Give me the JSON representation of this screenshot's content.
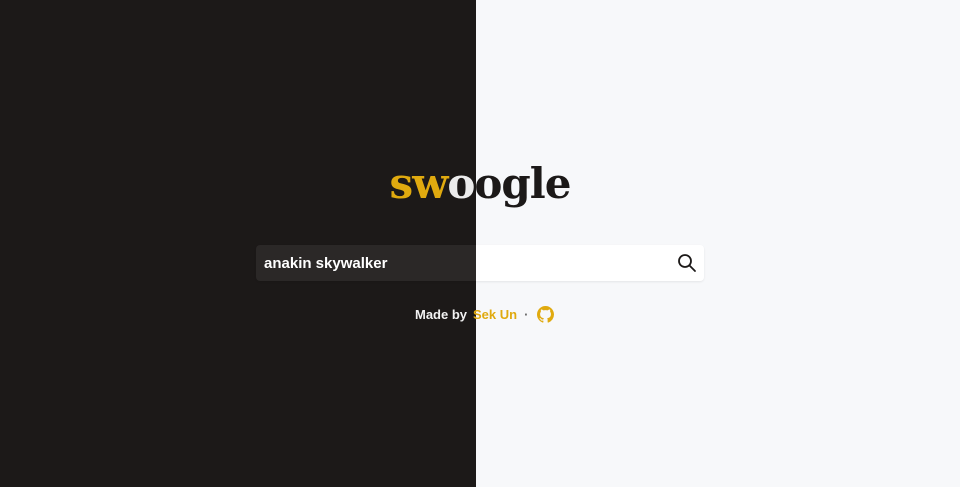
{
  "logo": {
    "part1": "sw",
    "part2": "o",
    "part3": "ogle"
  },
  "search": {
    "value": "anakin skywalker",
    "button_icon": "search-icon"
  },
  "footer": {
    "made_by": "Made by",
    "author": "Sek Un",
    "separator": "·",
    "github_icon": "github-icon"
  },
  "colors": {
    "accent": "#e0aa0f",
    "dark_bg": "#1c1918",
    "light_bg": "#f7f8fa"
  }
}
